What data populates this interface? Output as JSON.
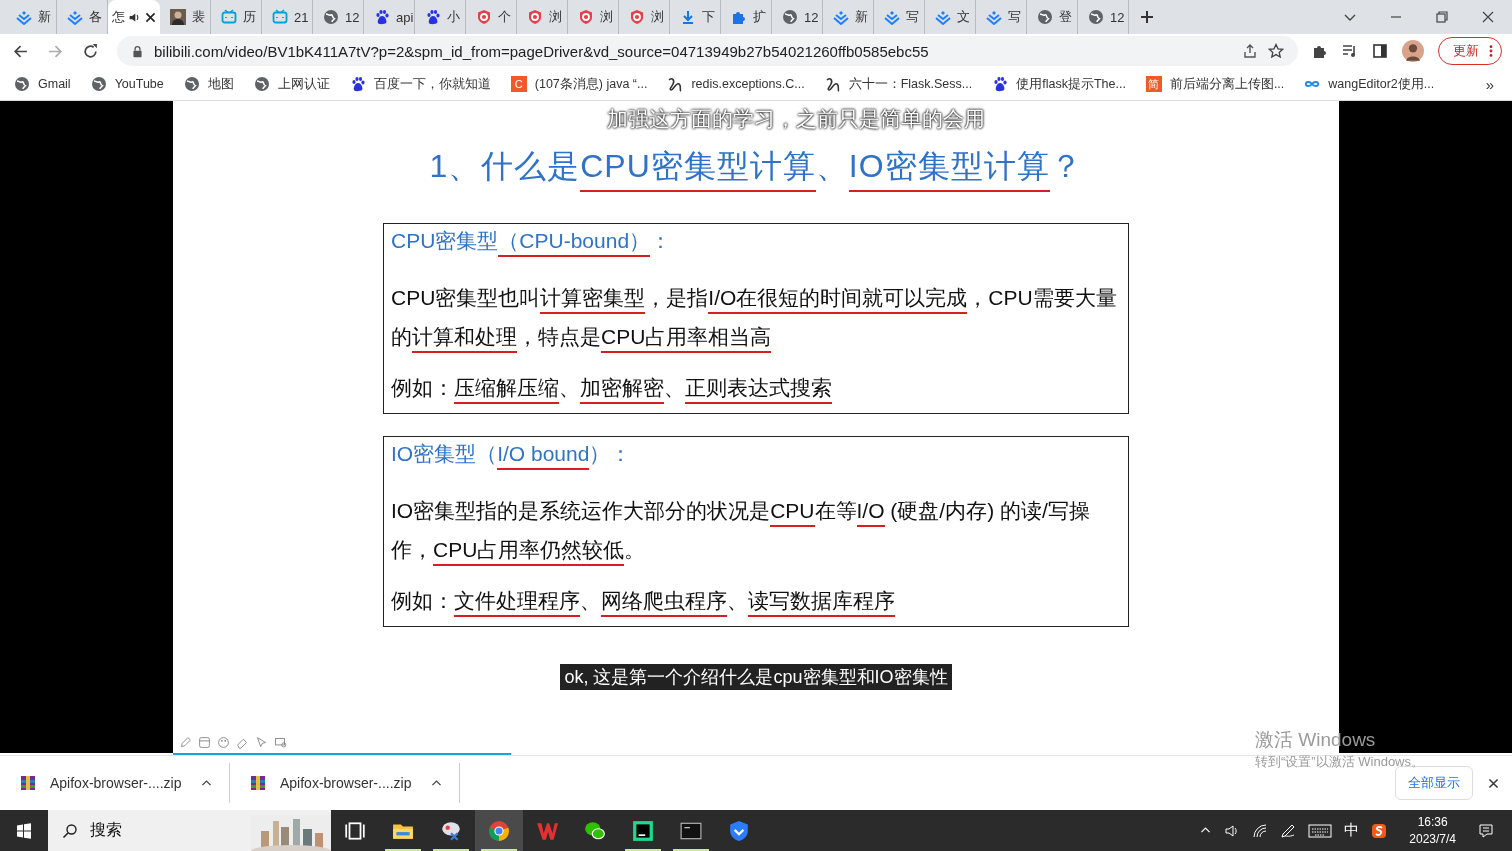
{
  "tabs": [
    {
      "title": "新",
      "kind": "juejin",
      "selected": false,
      "audio": false
    },
    {
      "title": "各",
      "kind": "juejin",
      "selected": false,
      "audio": false
    },
    {
      "title": "怎",
      "kind": "none",
      "selected": true,
      "audio": true
    },
    {
      "title": "裴",
      "selected": false,
      "audio": false
    },
    {
      "title": "历",
      "kind": "tv",
      "selected": false,
      "audio": false
    },
    {
      "title": "21",
      "kind": "tv",
      "selected": false,
      "audio": false
    },
    {
      "title": "12",
      "kind": "globe",
      "selected": false,
      "audio": false
    },
    {
      "title": "api",
      "kind": "paw",
      "selected": false,
      "audio": false
    },
    {
      "title": "小",
      "kind": "paw",
      "selected": false,
      "audio": false
    },
    {
      "title": "个",
      "kind": "ring",
      "selected": false,
      "audio": false
    },
    {
      "title": "浏",
      "kind": "ring",
      "selected": false,
      "audio": false
    },
    {
      "title": "浏",
      "kind": "ring",
      "selected": false,
      "audio": false
    },
    {
      "title": "浏",
      "kind": "ring",
      "selected": false,
      "audio": false
    },
    {
      "title": "下",
      "kind": "download",
      "selected": false,
      "audio": false
    },
    {
      "title": "扩",
      "kind": "puzzle",
      "selected": false,
      "audio": false
    },
    {
      "title": "12",
      "kind": "globe",
      "selected": false,
      "audio": false
    },
    {
      "title": "新",
      "kind": "juejin",
      "selected": false,
      "audio": false
    },
    {
      "title": "写",
      "kind": "juejin",
      "selected": false,
      "audio": false
    },
    {
      "title": "文",
      "kind": "juejin",
      "selected": false,
      "audio": false
    },
    {
      "title": "写",
      "kind": "juejin",
      "selected": false,
      "audio": false
    },
    {
      "title": "登",
      "kind": "globe",
      "selected": false,
      "audio": false
    },
    {
      "title": "12",
      "kind": "globe",
      "selected": false,
      "audio": false
    }
  ],
  "address_bar": {
    "url": "bilibili.com/video/BV1bK411A7tV?p=2&spm_id_from=pageDriver&vd_source=04713949b27b54021260ffb0585ebc55"
  },
  "update_button": "更新",
  "bookmarks": [
    {
      "title": "Gmail",
      "kind": "globe"
    },
    {
      "title": "YouTube",
      "kind": "globe"
    },
    {
      "title": "地图",
      "kind": "globe"
    },
    {
      "title": "上网认证",
      "kind": "globe"
    },
    {
      "title": "百度一下，你就知道",
      "kind": "paw"
    },
    {
      "title": "(107条消息) java “...",
      "kind": "badge",
      "badge": "C"
    },
    {
      "title": "redis.exceptions.C...",
      "kind": "scribble"
    },
    {
      "title": "六十一：Flask.Sess...",
      "kind": "scribble"
    },
    {
      "title": "使用flask提示The...",
      "kind": "paw"
    },
    {
      "title": "前后端分离上传图...",
      "kind": "badge",
      "badge": "简"
    },
    {
      "title": "wangEditor2使用...",
      "kind": "infinity"
    }
  ],
  "bookmarks_more": "»",
  "slide": {
    "top_subtitle": "加强这方面的学习，之前只是简单的会用",
    "heading": [
      {
        "text": "1、什么是",
        "underlined": false
      },
      {
        "text": "CPU密集型计算",
        "underlined": true
      },
      {
        "text": "、",
        "underlined": false
      },
      {
        "text": "IO密集型计算",
        "underlined": true
      },
      {
        "text": "？",
        "underlined": false
      }
    ],
    "boxes": [
      {
        "title": [
          {
            "text": "CPU密集型",
            "underlined": false
          },
          {
            "text": "（CPU-bound）",
            "underlined": true
          },
          {
            "text": "：",
            "underlined": false
          }
        ],
        "paragraph": [
          {
            "text": "CPU密集型也叫",
            "underlined": false
          },
          {
            "text": "计算密集型",
            "underlined": true
          },
          {
            "text": "，是指",
            "underlined": false
          },
          {
            "text": "I/O在很短的时间就可以完成",
            "underlined": true
          },
          {
            "text": "，CPU需要大量的",
            "underlined": false
          },
          {
            "text": "计算和处理",
            "underlined": true
          },
          {
            "text": "，特点是",
            "underlined": false
          },
          {
            "text": "CPU占用率相当高",
            "underlined": true
          }
        ],
        "example": [
          {
            "text": "例如：",
            "underlined": false
          },
          {
            "text": "压缩解压缩",
            "underlined": true
          },
          {
            "text": "、",
            "underlined": false
          },
          {
            "text": "加密解密",
            "underlined": true
          },
          {
            "text": "、",
            "underlined": false
          },
          {
            "text": "正则表达式搜索",
            "underlined": true
          }
        ]
      },
      {
        "title": [
          {
            "text": "IO密集型（",
            "underlined": false
          },
          {
            "text": "I/O bound",
            "underlined": true
          },
          {
            "text": "）：",
            "underlined": false
          }
        ],
        "paragraph": [
          {
            "text": "IO密集型指的是系统运作大部分的状况是",
            "underlined": false
          },
          {
            "text": "CPU",
            "underlined": true
          },
          {
            "text": "在等",
            "underlined": false
          },
          {
            "text": "I/O",
            "underlined": true
          },
          {
            "text": " (硬盘/内存) 的读/写操作，",
            "underlined": false
          },
          {
            "text": "CPU占用率仍然较低",
            "underlined": true
          },
          {
            "text": "。",
            "underlined": false
          }
        ],
        "example": [
          {
            "text": "例如：",
            "underlined": false
          },
          {
            "text": "文件处理程序",
            "underlined": true
          },
          {
            "text": "、",
            "underlined": false
          },
          {
            "text": "网络爬虫程序",
            "underlined": true
          },
          {
            "text": "、",
            "underlined": false
          },
          {
            "text": "读写数据库程序",
            "underlined": true
          }
        ]
      }
    ],
    "bottom_subtitle": "ok, 这是第一个介绍什么是cpu密集型和IO密集性",
    "progress": {
      "level": 0.29
    }
  },
  "activation_notice": {
    "title": "激活 Windows",
    "text": "转到“设置”以激活 Windows。"
  },
  "downloads": [
    {
      "file": "Apifox-browser-....zip"
    },
    {
      "file": "Apifox-browser-....zip"
    }
  ],
  "show_all_button": "全部显示",
  "taskbar": {
    "search_placeholder": "搜索",
    "apps": [
      {
        "kind": "taskview",
        "running": false,
        "selected": false
      },
      {
        "kind": "folder",
        "running": true,
        "selected": false
      },
      {
        "kind": "paint",
        "running": true,
        "selected": false
      },
      {
        "kind": "chrome",
        "running": true,
        "selected": true
      },
      {
        "kind": "wps",
        "running": false,
        "selected": false
      },
      {
        "kind": "wechat",
        "running": false,
        "selected": false
      },
      {
        "kind": "pycharm",
        "running": true,
        "selected": false
      },
      {
        "kind": "terminal",
        "running": true,
        "selected": false
      },
      {
        "kind": "shield",
        "running": false,
        "selected": false
      }
    ],
    "ime": "中",
    "time": "16:36",
    "date": "2023/7/4"
  }
}
